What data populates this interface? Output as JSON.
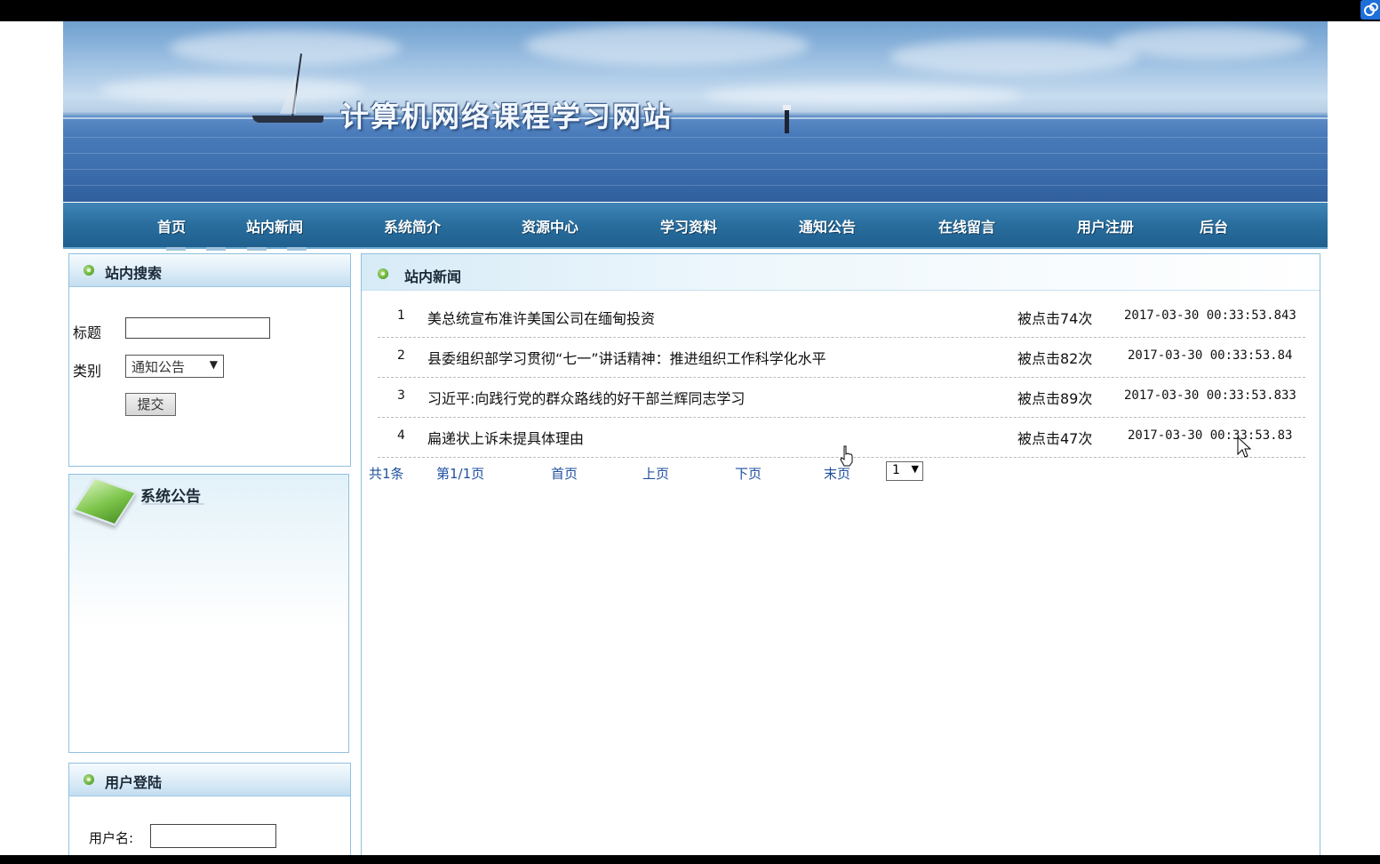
{
  "site": {
    "title": "计算机网络课程学习网站"
  },
  "nav": {
    "items": [
      {
        "label": "首页"
      },
      {
        "label": "站内新闻"
      },
      {
        "label": "系统简介"
      },
      {
        "label": "资源中心"
      },
      {
        "label": "学习资料"
      },
      {
        "label": "通知公告"
      },
      {
        "label": "在线留言"
      },
      {
        "label": "用户注册"
      },
      {
        "label": "后台"
      }
    ]
  },
  "search_panel": {
    "title": "站内搜索",
    "title_label": "标题",
    "title_value": "",
    "category_label": "类别",
    "category_value": "通知公告",
    "submit_label": "提交"
  },
  "notice_panel": {
    "title": "系统公告"
  },
  "login_panel": {
    "title": "用户登陆",
    "username_label": "用户名:",
    "username_value": ""
  },
  "news_panel": {
    "title": "站内新闻",
    "rows": [
      {
        "num": "1",
        "title": "美总统宣布准许美国公司在缅甸投资",
        "clicks": "被点击74次",
        "time": "2017-03-30 00:33:53.843"
      },
      {
        "num": "2",
        "title": "县委组织部学习贯彻“七一”讲话精神：推进组织工作科学化水平",
        "clicks": "被点击82次",
        "time": "2017-03-30 00:33:53.84"
      },
      {
        "num": "3",
        "title": "习近平:向践行党的群众路线的好干部兰辉同志学习",
        "clicks": "被点击89次",
        "time": "2017-03-30 00:33:53.833"
      },
      {
        "num": "4",
        "title": "扁递状上诉未提具体理由",
        "clicks": "被点击47次",
        "time": "2017-03-30 00:33:53.83"
      }
    ],
    "pager": {
      "total": "共1条",
      "page_info": "第1/1页",
      "first": "首页",
      "prev": "上页",
      "next": "下页",
      "last": "末页",
      "page_select": "1"
    }
  },
  "colors": {
    "nav_bg": "#2a6f9f",
    "panel_border": "#8fc0e0",
    "link": "#1f4f9f"
  }
}
